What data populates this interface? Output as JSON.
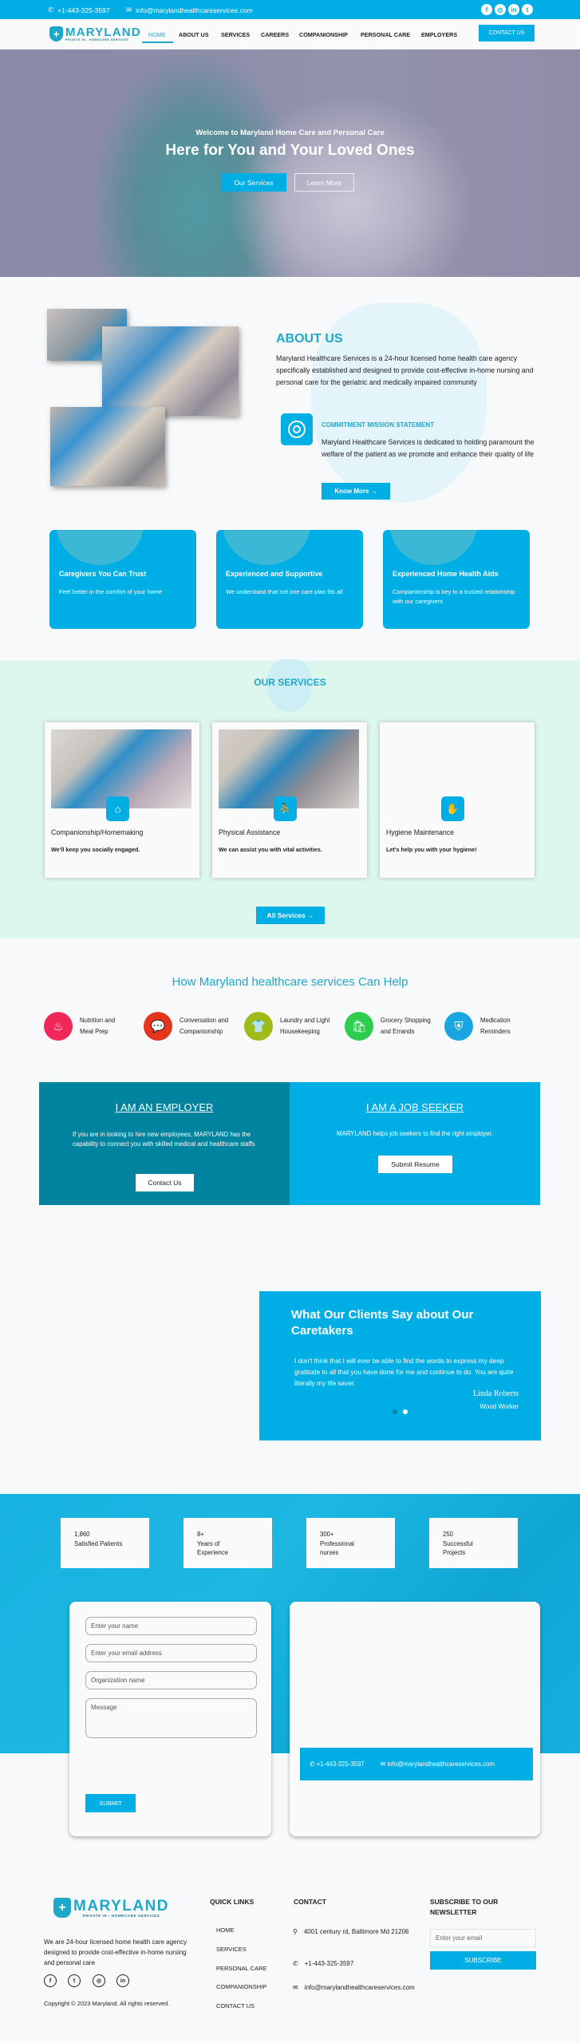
{
  "topbar": {
    "phone": "+1-443-325-3597",
    "email": "info@marylandhealthcareservices.com",
    "social": [
      {
        "icon": "facebook-icon",
        "glyph": "f"
      },
      {
        "icon": "instagram-icon",
        "glyph": "◎"
      },
      {
        "icon": "linkedin-icon",
        "glyph": "in"
      },
      {
        "icon": "twitter-icon",
        "glyph": "t"
      }
    ]
  },
  "brand": {
    "name": "MARYLAND",
    "tagline": "PRIVATE IN - HOMECARE SERVICES",
    "mark": "+"
  },
  "nav": {
    "items": [
      "HOME",
      "ABOUT US",
      "SERVICES",
      "CAREERS",
      "COMPANIONSHIP",
      "PERSONAL CARE",
      "EMPLOYERS"
    ],
    "active": "HOME",
    "cta": "CONTACT US"
  },
  "hero": {
    "subtitle": "Welcome to Maryland Home Care and Personal Care",
    "title": "Here for You and Your Loved Ones",
    "primary_button": "Our Services",
    "secondary_button": "Learn More"
  },
  "about": {
    "heading": "ABOUT US",
    "text": "Maryland Healthcare Services is a 24-hour licensed home health care agency specifically established and designed to provide cost-effective in-home nursing and personal care for the geriatric and medically impaired community",
    "mission_title": "COMMITMENT MISSION STATEMENT",
    "mission_text": "Maryland Healthcare Services is dedicated to holding paramount the welfare of the patient as we promote and enhance their quality of life",
    "button": "Know More →"
  },
  "features": [
    {
      "title": "Caregivers You Can Trust",
      "text": "Feel better in the comfort of your home"
    },
    {
      "title": "Experienced and Supportive",
      "text": "We understand that not one care plan fits all"
    },
    {
      "title": "Experienced Home Health Aids",
      "text": "Companionship is key to a trusted relationship with our caregivers"
    }
  ],
  "services": {
    "heading": "OUR SERVICES",
    "cards": [
      {
        "title": "Companionship/Homemaking",
        "text": "We'll keep you socially engaged.",
        "icon": "home-icon",
        "glyph": "⌂"
      },
      {
        "title": "Physical Assistance",
        "text": "We can assist you with vital activities.",
        "icon": "person-assist-icon",
        "glyph": "⛹"
      },
      {
        "title": "Hygiene Maintenance",
        "text": "Let's help you with your hygiene!",
        "icon": "hygiene-glove-icon",
        "glyph": "✋"
      }
    ],
    "button": "All Services →"
  },
  "help": {
    "heading": "How Maryland healthcare services Can Help",
    "items": [
      {
        "line1": "Nutrition and",
        "line2": "Meal Prep",
        "color": "#f0285a",
        "icon": "meal-cloche-icon",
        "glyph": "♨"
      },
      {
        "line1": "Conversation and",
        "line2": "Companionship",
        "color": "#e5361c",
        "icon": "chat-bubbles-icon",
        "glyph": "💬"
      },
      {
        "line1": "Laundry and Light",
        "line2": "Housekeeping",
        "color": "#9fbb17",
        "icon": "shirt-icon",
        "glyph": "👕"
      },
      {
        "line1": "Grocery Shopping",
        "line2": "and Errands",
        "color": "#2ecc4f",
        "icon": "grocery-bag-icon",
        "glyph": "🛍"
      },
      {
        "line1": "Medication",
        "line2": "Reminders",
        "color": "#19a6e0",
        "icon": "medical-shield-icon",
        "glyph": "⛨"
      }
    ]
  },
  "employer": {
    "heading": "I AM AN EMPLOYER",
    "text": "If you are in looking to hire new employees, MARYLAND has the capability to connect you with skilled medical and healthcare staffs",
    "button": "Contact Us"
  },
  "seeker": {
    "heading": "I AM A JOB SEEKER",
    "text": "MARYLAND helps job seekers to find the right employer.",
    "button": "Submit Resume"
  },
  "testimonial": {
    "heading": "What Our Clients Say about Our Caretakers",
    "quote": "I don't think that I will ever be able to find the words to express my deep gratitude to all that you have done for me and continue to do. You are quite literally my life saver.",
    "name": "Linda Roberts",
    "role": "Wood Worker",
    "slides": 2,
    "active_slide": 2
  },
  "stats": [
    {
      "value": "1,860",
      "label": "Satisfied Patients"
    },
    {
      "value": "8+",
      "label": "Years of Experience"
    },
    {
      "value": "300+",
      "label": "Professional nurses"
    },
    {
      "value": "250",
      "label": "Successful Projects"
    }
  ],
  "contact_form": {
    "name_placeholder": "Enter your name",
    "email_placeholder": "Enter your email address",
    "org_placeholder": "Organization name",
    "message_placeholder": "Message",
    "submit": "SUBMIT",
    "phone": "+1-443-325-3597",
    "email": "info@marylandhealthcareservices.com"
  },
  "footer": {
    "description": "We are 24-hour licensed home health care agency designed to provide cost-effective in-home nursing and personal care",
    "social": [
      {
        "icon": "facebook-icon",
        "glyph": "f"
      },
      {
        "icon": "twitter-icon",
        "glyph": "t"
      },
      {
        "icon": "instagram-icon",
        "glyph": "◎"
      },
      {
        "icon": "linkedin-icon",
        "glyph": "in"
      }
    ],
    "copyright": "Copyright © 2023 Maryland. All rights reserved.",
    "quick_links_heading": "QUICK LINKS",
    "quick_links": [
      "HOME",
      "SERVICES",
      "PERSONAL CARE",
      "COMPANIONSHIP",
      "CONTACT US"
    ],
    "contact_heading": "CONTACT",
    "address": "4001 century rd, Baltimore Md 21206",
    "phone": "+1-443-325-3597",
    "email": "info@marylandhealthcareservices.com",
    "newsletter_heading": "SUBSCRIBE TO OUR NEWSLETTER",
    "newsletter_placeholder": "Enter your email",
    "subscribe": "SUBSCRIBE"
  },
  "colors": {
    "primary": "#00aee6",
    "brand": "#1ea7c8",
    "teal_dark": "#00839e",
    "services_bg": "#ddf6ee"
  }
}
